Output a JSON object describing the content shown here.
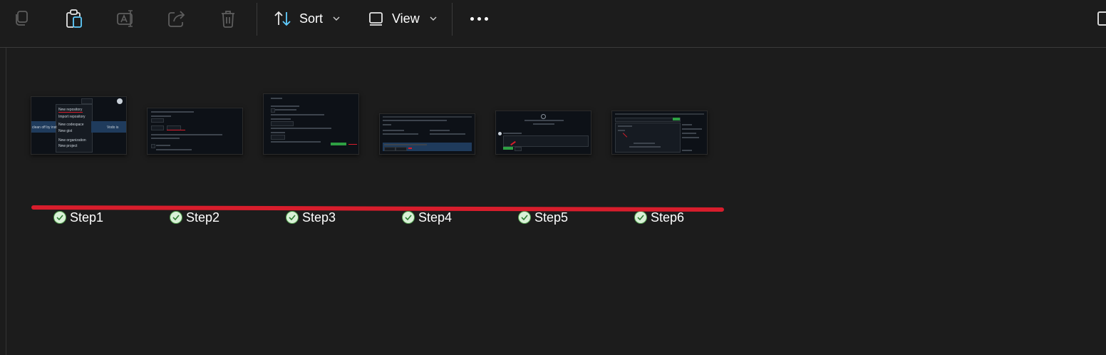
{
  "toolbar": {
    "icons": [
      "copy-icon",
      "paste-icon",
      "rename-icon",
      "share-icon",
      "delete-icon"
    ],
    "sort_label": "Sort",
    "view_label": "View",
    "more_icon": "more-options-icon"
  },
  "files": [
    {
      "name": "Step1",
      "status_icon": "synced-check-icon"
    },
    {
      "name": "Step2",
      "status_icon": "synced-check-icon"
    },
    {
      "name": "Step3",
      "status_icon": "synced-check-icon"
    },
    {
      "name": "Step4",
      "status_icon": "synced-check-icon"
    },
    {
      "name": "Step5",
      "status_icon": "synced-check-icon"
    },
    {
      "name": "Step6",
      "status_icon": "synced-check-icon"
    }
  ],
  "thumbnails": {
    "step1_text_a": "New repository",
    "step1_text_b": "Import repository",
    "step1_text_c": "New codespace",
    "step1_text_d": "New gist",
    "step1_text_e": "New organization",
    "step1_text_f": "New project",
    "step1_text_side": "clean off by inst",
    "step1_text_side2": "Vodo is"
  },
  "colors": {
    "background": "#1c1c1c",
    "annotation_red": "#d81d2c",
    "check_green": "#4e9a4a",
    "accent_blue": "#60cdff"
  }
}
